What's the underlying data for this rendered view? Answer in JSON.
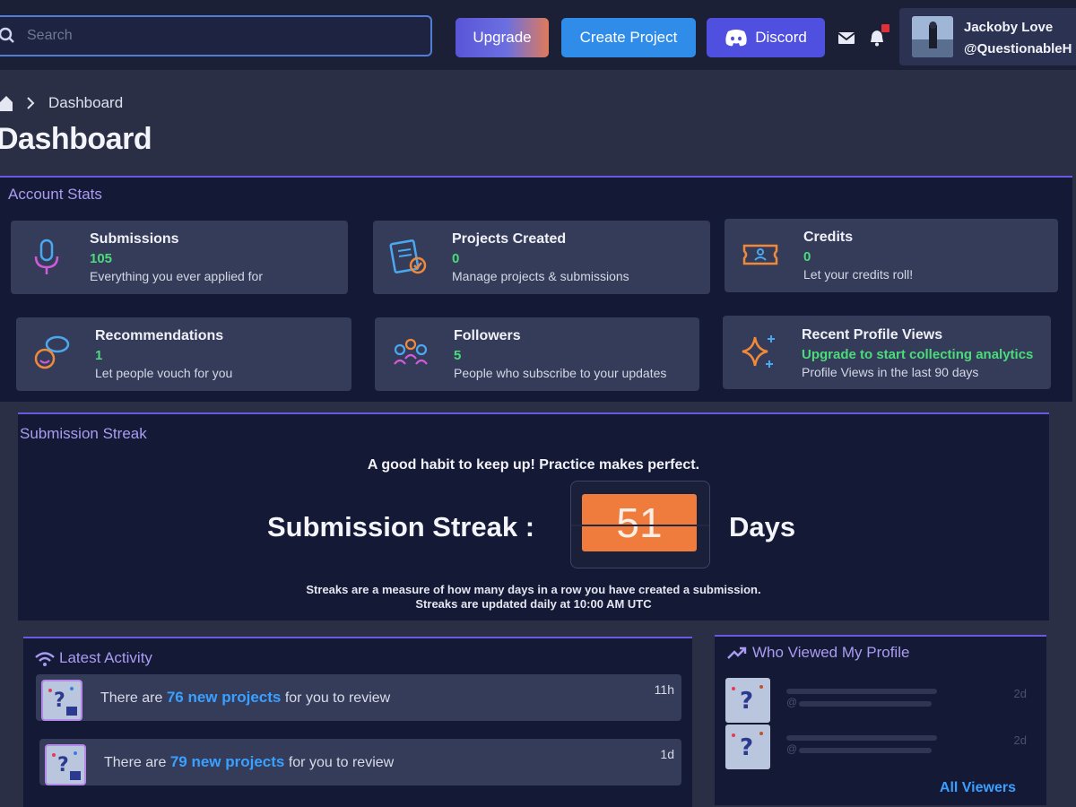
{
  "search": {
    "placeholder": "Search"
  },
  "header": {
    "upgrade_label": "Upgrade",
    "create_project_label": "Create Project",
    "discord_label": "Discord"
  },
  "profile": {
    "name": "Jackoby Love",
    "handle": "@QuestionableH"
  },
  "breadcrumb": {
    "current": "Dashboard"
  },
  "page_title": "Dashboard",
  "account_stats": {
    "title": "Account Stats",
    "cards": [
      {
        "icon": "microphone-icon",
        "label": "Submissions",
        "value": "105",
        "desc": "Everything you ever applied for"
      },
      {
        "icon": "clipboard-check-icon",
        "label": "Projects Created",
        "value": "0",
        "desc": "Manage projects & submissions"
      },
      {
        "icon": "ticket-icon",
        "label": "Credits",
        "value": "0",
        "desc": "Let your credits roll!"
      },
      {
        "icon": "chat-person-icon",
        "label": "Recommendations",
        "value": "1",
        "desc": "Let people vouch for you"
      },
      {
        "icon": "people-group-icon",
        "label": "Followers",
        "value": "5",
        "desc": "People who subscribe to your updates"
      },
      {
        "icon": "sparkle-icon",
        "label": "Recent Profile Views",
        "value": "Upgrade to start collecting analytics",
        "desc": "Profile Views in the last 90 days"
      }
    ]
  },
  "streak": {
    "title": "Submission Streak",
    "subtitle": "A good habit to keep up! Practice makes perfect.",
    "label": "Submission Streak :",
    "count": "51",
    "unit": "Days",
    "note1": "Streaks are a measure of how many days in a row you have created a submission.",
    "note2": "Streaks are updated daily at 10:00 AM UTC"
  },
  "latest_activity": {
    "title": "Latest Activity",
    "items": [
      {
        "prefix": "There are ",
        "highlight": "76 new projects",
        "suffix": " for you to review",
        "time": "11h"
      },
      {
        "prefix": "There are ",
        "highlight": "79 new projects",
        "suffix": " for you to review",
        "time": "1d"
      }
    ]
  },
  "viewers": {
    "title": "Who Viewed My Profile",
    "items": [
      {
        "at": "@",
        "time": "2d"
      },
      {
        "at": "@",
        "time": "2d"
      }
    ],
    "all_label": "All Viewers"
  },
  "colors": {
    "accent": "#6a5ae0",
    "highlight": "#3aa0ff",
    "green": "#4bdb7a",
    "streak": "#ef7b3d"
  }
}
